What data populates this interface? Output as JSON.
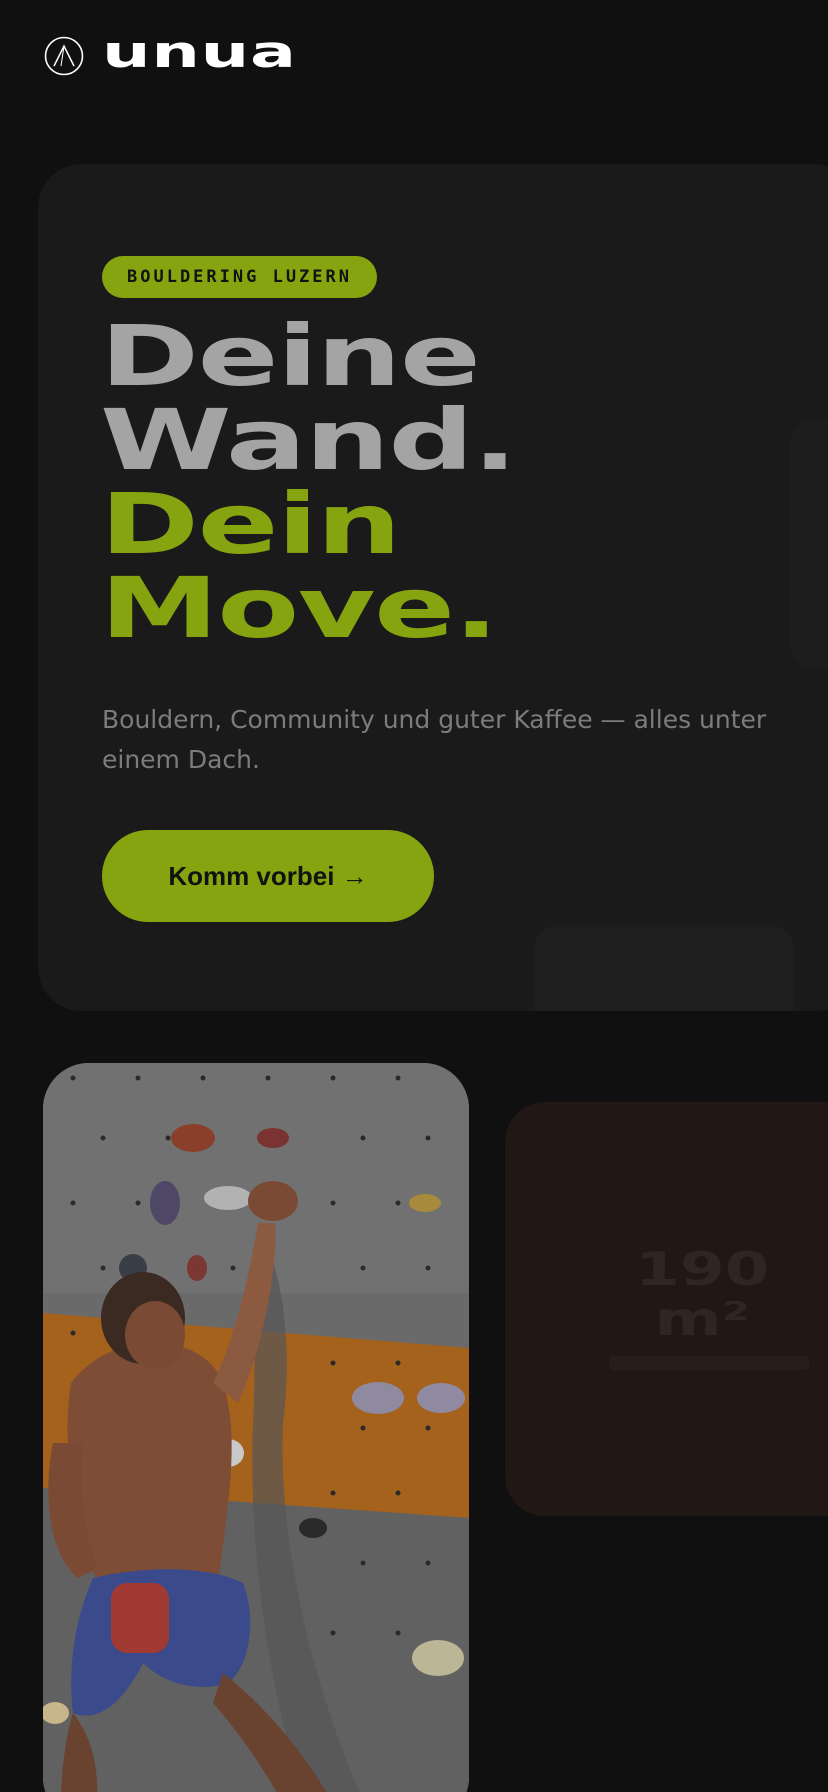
{
  "header": {
    "logo_text": "unua"
  },
  "hero": {
    "badge": "BOULDERING LUZERN",
    "headline": {
      "line1": "Deine",
      "line2": "Wand.",
      "line3": "Dein",
      "line4": "Move."
    },
    "subline": "Bouldern, Community und guter Kaffee — alles unter einem Dach.",
    "cta_label": "Komm vorbei →"
  },
  "stat": {
    "value": "190",
    "unit": "m²"
  },
  "colors": {
    "background": "#101010",
    "card": "#1a1a1a",
    "accent": "#86a40f",
    "headline_gray": "#a4a4a4",
    "body_text": "#7c7c7c",
    "stat_card": "#211816"
  },
  "icons": {
    "logo": "mountain-circle-icon",
    "cta_arrow": "arrow-right-icon"
  }
}
